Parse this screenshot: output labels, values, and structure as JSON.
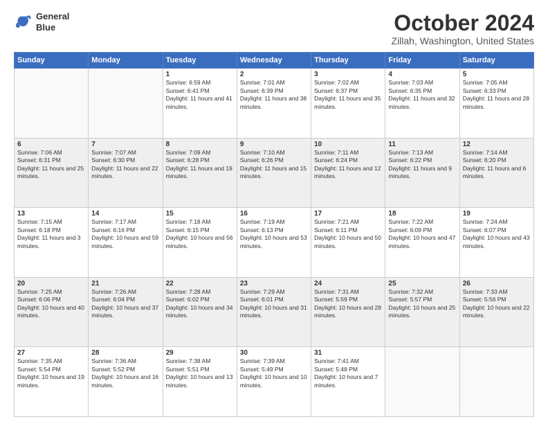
{
  "logo": {
    "line1": "General",
    "line2": "Blue"
  },
  "title": "October 2024",
  "subtitle": "Zillah, Washington, United States",
  "days_header": [
    "Sunday",
    "Monday",
    "Tuesday",
    "Wednesday",
    "Thursday",
    "Friday",
    "Saturday"
  ],
  "weeks": [
    [
      {
        "day": "",
        "content": ""
      },
      {
        "day": "",
        "content": ""
      },
      {
        "day": "1",
        "content": "Sunrise: 6:59 AM\nSunset: 6:41 PM\nDaylight: 11 hours and 41 minutes."
      },
      {
        "day": "2",
        "content": "Sunrise: 7:01 AM\nSunset: 6:39 PM\nDaylight: 11 hours and 38 minutes."
      },
      {
        "day": "3",
        "content": "Sunrise: 7:02 AM\nSunset: 6:37 PM\nDaylight: 11 hours and 35 minutes."
      },
      {
        "day": "4",
        "content": "Sunrise: 7:03 AM\nSunset: 6:35 PM\nDaylight: 11 hours and 32 minutes."
      },
      {
        "day": "5",
        "content": "Sunrise: 7:05 AM\nSunset: 6:33 PM\nDaylight: 11 hours and 28 minutes."
      }
    ],
    [
      {
        "day": "6",
        "content": "Sunrise: 7:06 AM\nSunset: 6:31 PM\nDaylight: 11 hours and 25 minutes."
      },
      {
        "day": "7",
        "content": "Sunrise: 7:07 AM\nSunset: 6:30 PM\nDaylight: 11 hours and 22 minutes."
      },
      {
        "day": "8",
        "content": "Sunrise: 7:09 AM\nSunset: 6:28 PM\nDaylight: 11 hours and 19 minutes."
      },
      {
        "day": "9",
        "content": "Sunrise: 7:10 AM\nSunset: 6:26 PM\nDaylight: 11 hours and 15 minutes."
      },
      {
        "day": "10",
        "content": "Sunrise: 7:11 AM\nSunset: 6:24 PM\nDaylight: 11 hours and 12 minutes."
      },
      {
        "day": "11",
        "content": "Sunrise: 7:13 AM\nSunset: 6:22 PM\nDaylight: 11 hours and 9 minutes."
      },
      {
        "day": "12",
        "content": "Sunrise: 7:14 AM\nSunset: 6:20 PM\nDaylight: 11 hours and 6 minutes."
      }
    ],
    [
      {
        "day": "13",
        "content": "Sunrise: 7:15 AM\nSunset: 6:18 PM\nDaylight: 11 hours and 3 minutes."
      },
      {
        "day": "14",
        "content": "Sunrise: 7:17 AM\nSunset: 6:16 PM\nDaylight: 10 hours and 59 minutes."
      },
      {
        "day": "15",
        "content": "Sunrise: 7:18 AM\nSunset: 6:15 PM\nDaylight: 10 hours and 56 minutes."
      },
      {
        "day": "16",
        "content": "Sunrise: 7:19 AM\nSunset: 6:13 PM\nDaylight: 10 hours and 53 minutes."
      },
      {
        "day": "17",
        "content": "Sunrise: 7:21 AM\nSunset: 6:11 PM\nDaylight: 10 hours and 50 minutes."
      },
      {
        "day": "18",
        "content": "Sunrise: 7:22 AM\nSunset: 6:09 PM\nDaylight: 10 hours and 47 minutes."
      },
      {
        "day": "19",
        "content": "Sunrise: 7:24 AM\nSunset: 6:07 PM\nDaylight: 10 hours and 43 minutes."
      }
    ],
    [
      {
        "day": "20",
        "content": "Sunrise: 7:25 AM\nSunset: 6:06 PM\nDaylight: 10 hours and 40 minutes."
      },
      {
        "day": "21",
        "content": "Sunrise: 7:26 AM\nSunset: 6:04 PM\nDaylight: 10 hours and 37 minutes."
      },
      {
        "day": "22",
        "content": "Sunrise: 7:28 AM\nSunset: 6:02 PM\nDaylight: 10 hours and 34 minutes."
      },
      {
        "day": "23",
        "content": "Sunrise: 7:29 AM\nSunset: 6:01 PM\nDaylight: 10 hours and 31 minutes."
      },
      {
        "day": "24",
        "content": "Sunrise: 7:31 AM\nSunset: 5:59 PM\nDaylight: 10 hours and 28 minutes."
      },
      {
        "day": "25",
        "content": "Sunrise: 7:32 AM\nSunset: 5:57 PM\nDaylight: 10 hours and 25 minutes."
      },
      {
        "day": "26",
        "content": "Sunrise: 7:33 AM\nSunset: 5:56 PM\nDaylight: 10 hours and 22 minutes."
      }
    ],
    [
      {
        "day": "27",
        "content": "Sunrise: 7:35 AM\nSunset: 5:54 PM\nDaylight: 10 hours and 19 minutes."
      },
      {
        "day": "28",
        "content": "Sunrise: 7:36 AM\nSunset: 5:52 PM\nDaylight: 10 hours and 16 minutes."
      },
      {
        "day": "29",
        "content": "Sunrise: 7:38 AM\nSunset: 5:51 PM\nDaylight: 10 hours and 13 minutes."
      },
      {
        "day": "30",
        "content": "Sunrise: 7:39 AM\nSunset: 5:49 PM\nDaylight: 10 hours and 10 minutes."
      },
      {
        "day": "31",
        "content": "Sunrise: 7:41 AM\nSunset: 5:48 PM\nDaylight: 10 hours and 7 minutes."
      },
      {
        "day": "",
        "content": ""
      },
      {
        "day": "",
        "content": ""
      }
    ]
  ]
}
